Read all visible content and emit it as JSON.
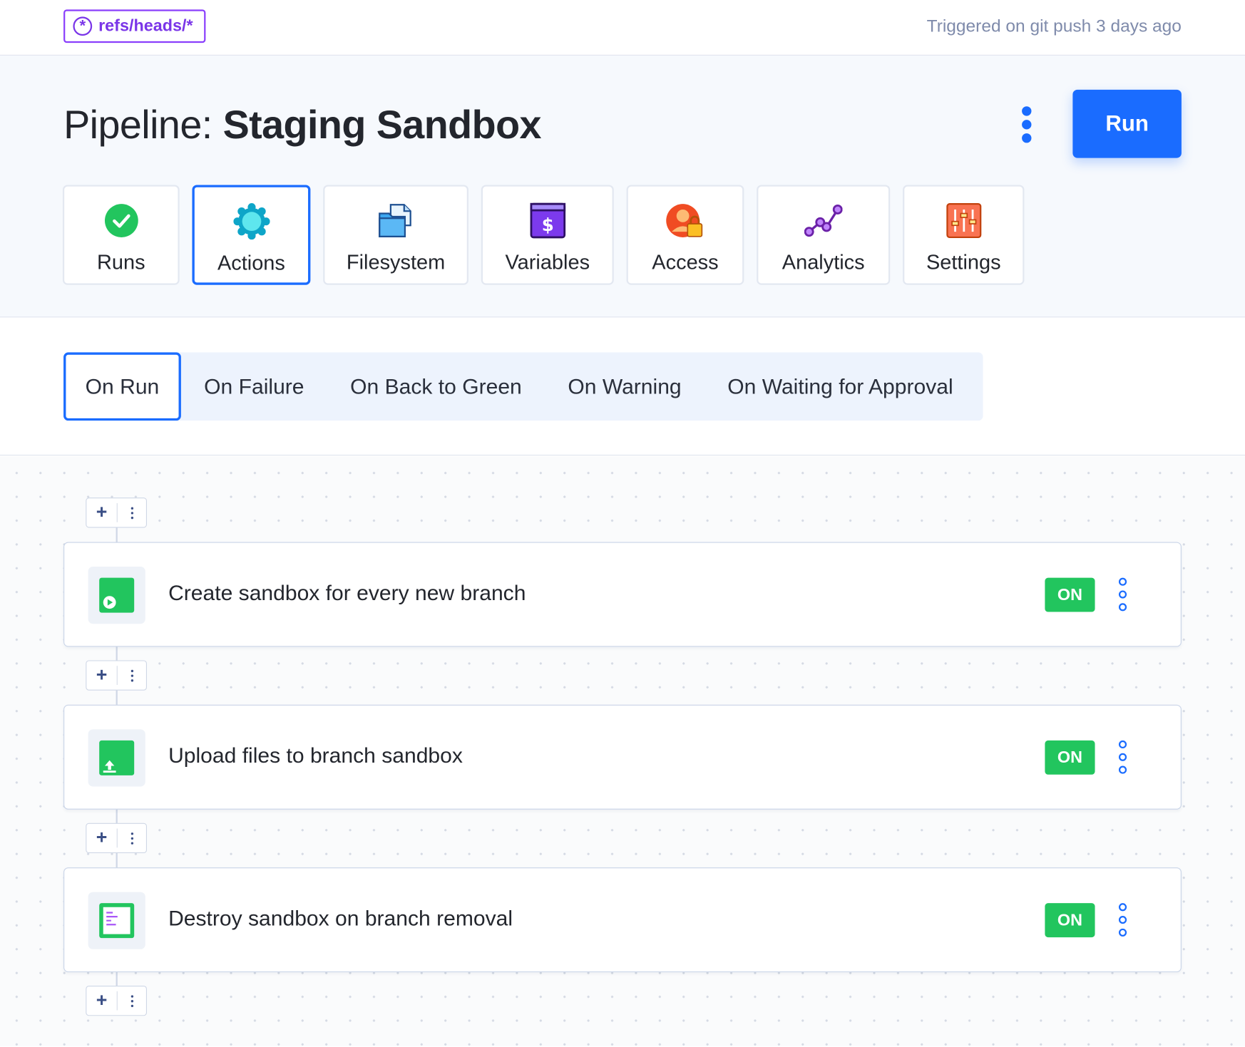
{
  "topbar": {
    "branch": "refs/heads/*",
    "triggered": "Triggered on git push 3 days ago"
  },
  "header": {
    "title_prefix": "Pipeline:",
    "title_name": "Staging Sandbox",
    "run_label": "Run"
  },
  "nav": {
    "items": [
      {
        "label": "Runs",
        "icon": "check-circle-icon"
      },
      {
        "label": "Actions",
        "icon": "gear-icon"
      },
      {
        "label": "Filesystem",
        "icon": "folder-icon"
      },
      {
        "label": "Variables",
        "icon": "dollar-icon"
      },
      {
        "label": "Access",
        "icon": "user-lock-icon"
      },
      {
        "label": "Analytics",
        "icon": "analytics-icon"
      },
      {
        "label": "Settings",
        "icon": "sliders-icon"
      }
    ],
    "active": "Actions"
  },
  "tabs": {
    "items": [
      "On Run",
      "On Failure",
      "On Back to Green",
      "On Warning",
      "On Waiting for Approval"
    ],
    "active": "On Run"
  },
  "actions": [
    {
      "title": "Create sandbox for every new branch",
      "status": "ON",
      "icon": "play-icon"
    },
    {
      "title": "Upload files to branch sandbox",
      "status": "ON",
      "icon": "upload-icon"
    },
    {
      "title": "Destroy sandbox on branch removal",
      "status": "ON",
      "icon": "terminal-icon"
    }
  ],
  "colors": {
    "accent": "#1a6cff",
    "on_badge": "#22c55e",
    "branch_badge": "#8a3ffc"
  }
}
